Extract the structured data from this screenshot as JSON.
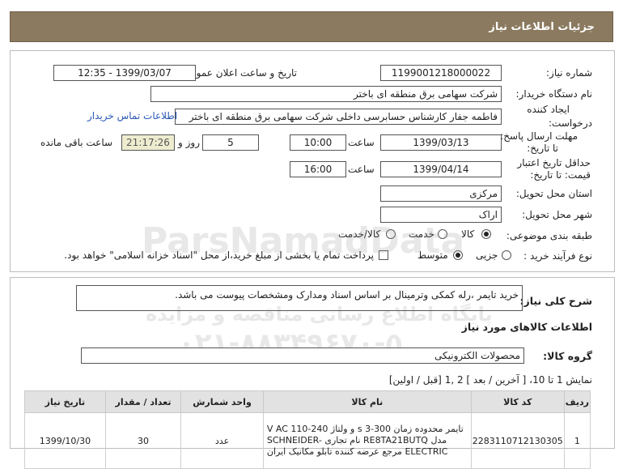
{
  "header": {
    "title": "جزئیات اطلاعات نیاز"
  },
  "fields": {
    "need_number_label": "شماره نیاز:",
    "need_number": "1199001218000022",
    "announce_label": "تاریخ و ساعت اعلان عمومی:",
    "announce_value": "1399/03/07 - 12:35",
    "buyer_label": "نام دستگاه خریدار:",
    "buyer_value": "شرکت سهامی برق منطقه ای باختر",
    "creator_label_1": "ایجاد کننده",
    "creator_label_2": "درخواست:",
    "creator_value": "فاطمه جفار کارشناس حسابرسی داخلی شرکت سهامی برق منطقه ای باختر",
    "contact_link": "اطلاعات تماس خریدار",
    "send_deadline_label_1": "مهلت ارسال پاسخ:",
    "send_deadline_label_2": "تا تاریخ:",
    "send_date": "1399/03/13",
    "time_label": "ساعت",
    "send_time": "10:00",
    "days_value": "5",
    "days_label": "روز و",
    "remaining_time": "21:17:26",
    "remaining_label": "ساعت باقی مانده",
    "price_validity_label_1": "حداقل تاریخ اعتبار",
    "price_validity_label_2": "قیمت: تا تاریخ:",
    "price_date": "1399/04/14",
    "price_time": "16:00",
    "province_label": "استان محل تحویل:",
    "province_value": "مرکزی",
    "city_label": "شهر محل تحویل:",
    "city_value": "اراک",
    "category_label": "طبقه بندی موضوعی:",
    "category_options": [
      "کالا",
      "خدمت",
      "کالا/خدمت"
    ],
    "process_label": "نوع فرآیند خرید :",
    "process_options": [
      "جزیی",
      "متوسط"
    ],
    "payment_note": "پرداخت تمام یا بخشی از مبلغ خرید،از محل \"اسناد خزانه اسلامی\" خواهد بود."
  },
  "description": {
    "label": "شرح کلی نیاز:",
    "value": "خرید تایمر ،رله کمکی وترمینال بر اساس اسناد ومدارک ومشخصات پیوست می باشد."
  },
  "goods": {
    "section_title": "اطلاعات کالاهای مورد نیاز",
    "group_label": "گروه کالا:",
    "group_value": "محصولات الکترونیکی",
    "pagination": "نمایش 1 تا 10، [ آخرین / بعد ] 2 ,1 [قبل / اولین]",
    "columns": [
      "ردیف",
      "کد کالا",
      "نام کالا",
      "واحد شمارش",
      "تعداد / مقدار",
      "تاریخ نیاز"
    ],
    "rows": [
      {
        "index": "1",
        "code": "2283110712130305",
        "name": "تایمر محدوده زمان 300-3 s و ولتاژ V AC 110-240 مدل RE8TA21BUTQ نام تجاری SCHNEIDER-ELECTRIC مرجع عرضه کننده تابلو مکانیک ایران",
        "unit": "عدد",
        "qty": "30",
        "date": "1399/10/30"
      }
    ]
  },
  "watermark": {
    "brand": "ParsNamadData",
    "line1": "پایگاه اطلاع رسانی مناقصه و مزایده",
    "phone": "۰۲۱-۸۸۳۴۹۶۷۰-۵"
  }
}
